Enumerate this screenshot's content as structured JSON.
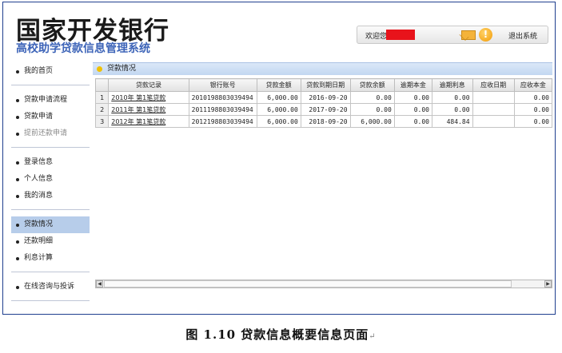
{
  "header": {
    "bank_name": "国家开发银行",
    "system_name": "高校助学贷款信息管理系统",
    "welcome": "欢迎您",
    "logout": "退出系统"
  },
  "sidebar": {
    "groups": [
      [
        {
          "label": "我的首页"
        }
      ],
      [
        {
          "label": "贷款申请流程"
        },
        {
          "label": "贷款申请"
        },
        {
          "label": "提前还款申请"
        }
      ],
      [
        {
          "label": "登录信息"
        },
        {
          "label": "个人信息"
        },
        {
          "label": "我的消息"
        }
      ],
      [
        {
          "label": "贷款情况"
        },
        {
          "label": "还款明细"
        },
        {
          "label": "利息计算"
        }
      ],
      [
        {
          "label": "在线咨询与投诉"
        }
      ]
    ]
  },
  "panel": {
    "title": "贷款情况",
    "columns": [
      "贷款记录",
      "银行账号",
      "贷款金额",
      "贷款到期日期",
      "贷款余额",
      "逾期本金",
      "逾期利息",
      "应收日期",
      "应收本金"
    ],
    "rows": [
      {
        "index": "1",
        "record": "2010年 第1笔贷款",
        "account": "2010198803039494",
        "amount": "6,000.00",
        "due_date": "2016-09-20",
        "balance": "0.00",
        "overdue_principal": "0.00",
        "overdue_interest": "0.00",
        "receivable_date": "",
        "receivable_principal": "0.00"
      },
      {
        "index": "2",
        "record": "2011年 第1笔贷款",
        "account": "2011198803039494",
        "amount": "6,000.00",
        "due_date": "2017-09-20",
        "balance": "0.00",
        "overdue_principal": "0.00",
        "overdue_interest": "0.00",
        "receivable_date": "",
        "receivable_principal": "0.00"
      },
      {
        "index": "3",
        "record": "2012年 第1笔贷款",
        "account": "2012198803039494",
        "amount": "6,000.00",
        "due_date": "2018-09-20",
        "balance": "6,000.00",
        "overdue_principal": "0.00",
        "overdue_interest": "484.84",
        "receivable_date": "",
        "receivable_principal": "0.00"
      }
    ]
  },
  "caption": "图 1.10  贷款信息概要信息页面",
  "caption_mark": "↵",
  "colors": {
    "active_nav": "#b7cdea",
    "brand_blue": "#3d64b8",
    "redaction": "#e8131b",
    "frame": "#1f3f8f"
  }
}
